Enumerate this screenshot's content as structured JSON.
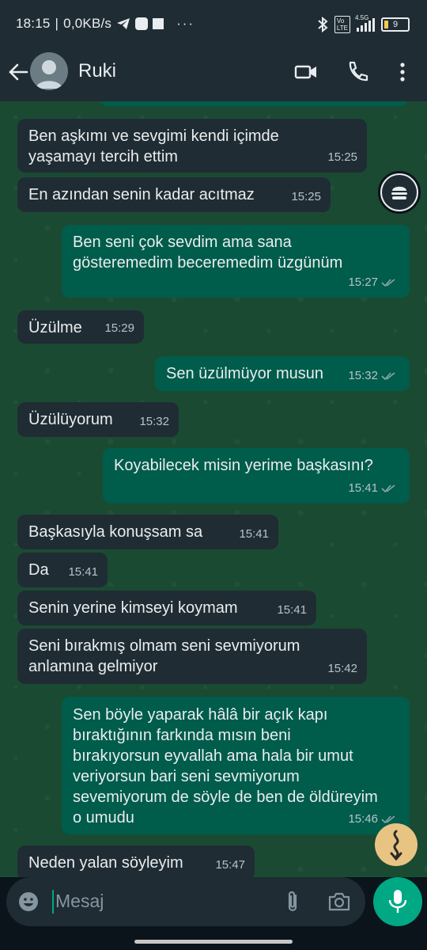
{
  "status": {
    "time": "18:15",
    "speed": "0,0KB/s",
    "battery": "9",
    "network": "4.5G"
  },
  "header": {
    "contact_name": "Ruki"
  },
  "messages": [
    {
      "dir": "in",
      "text": "Ben aşkımı ve sevgimi kendi içimde yaşamayı tercih ettim",
      "time": "15:25"
    },
    {
      "dir": "in",
      "text": "En azından senin kadar acıtmaz",
      "time": "15:25"
    },
    {
      "dir": "out",
      "text": "Ben seni çok sevdim ama sana gösteremedim beceremedim üzgünüm",
      "time": "15:27"
    },
    {
      "dir": "in",
      "text": "Üzülme",
      "time": "15:29"
    },
    {
      "dir": "out",
      "text": "Sen üzülmüyor musun",
      "time": "15:32"
    },
    {
      "dir": "in",
      "text": "Üzülüyorum",
      "time": "15:32"
    },
    {
      "dir": "out",
      "text": "Koyabilecek misin yerime başkasını?",
      "time": "15:41"
    },
    {
      "dir": "in",
      "text": "Başkasıyla konuşsam sa",
      "time": "15:41"
    },
    {
      "dir": "in",
      "text": "Da",
      "time": "15:41"
    },
    {
      "dir": "in",
      "text": "Senin yerine kimseyi koymam",
      "time": "15:41"
    },
    {
      "dir": "in",
      "text": "Seni bırakmış olmam seni sevmiyorum anlamına gelmiyor",
      "time": "15:42"
    },
    {
      "dir": "out",
      "text": "Sen böyle yaparak hâlâ bir açık kapı bıraktığının farkında mısın beni bırakıyorsun eyvallah ama hala bir umut veriyorsun bari seni sevmiyorum sevemiyorum de söyle de ben de öldüreyim o umudu",
      "time": "15:46"
    },
    {
      "dir": "in",
      "text": "Neden yalan söyleyim",
      "time": "15:47"
    }
  ],
  "composer": {
    "placeholder": "Mesaj"
  },
  "colors": {
    "incoming": "#202c33",
    "outgoing": "#005c4b",
    "accent": "#00a884"
  }
}
